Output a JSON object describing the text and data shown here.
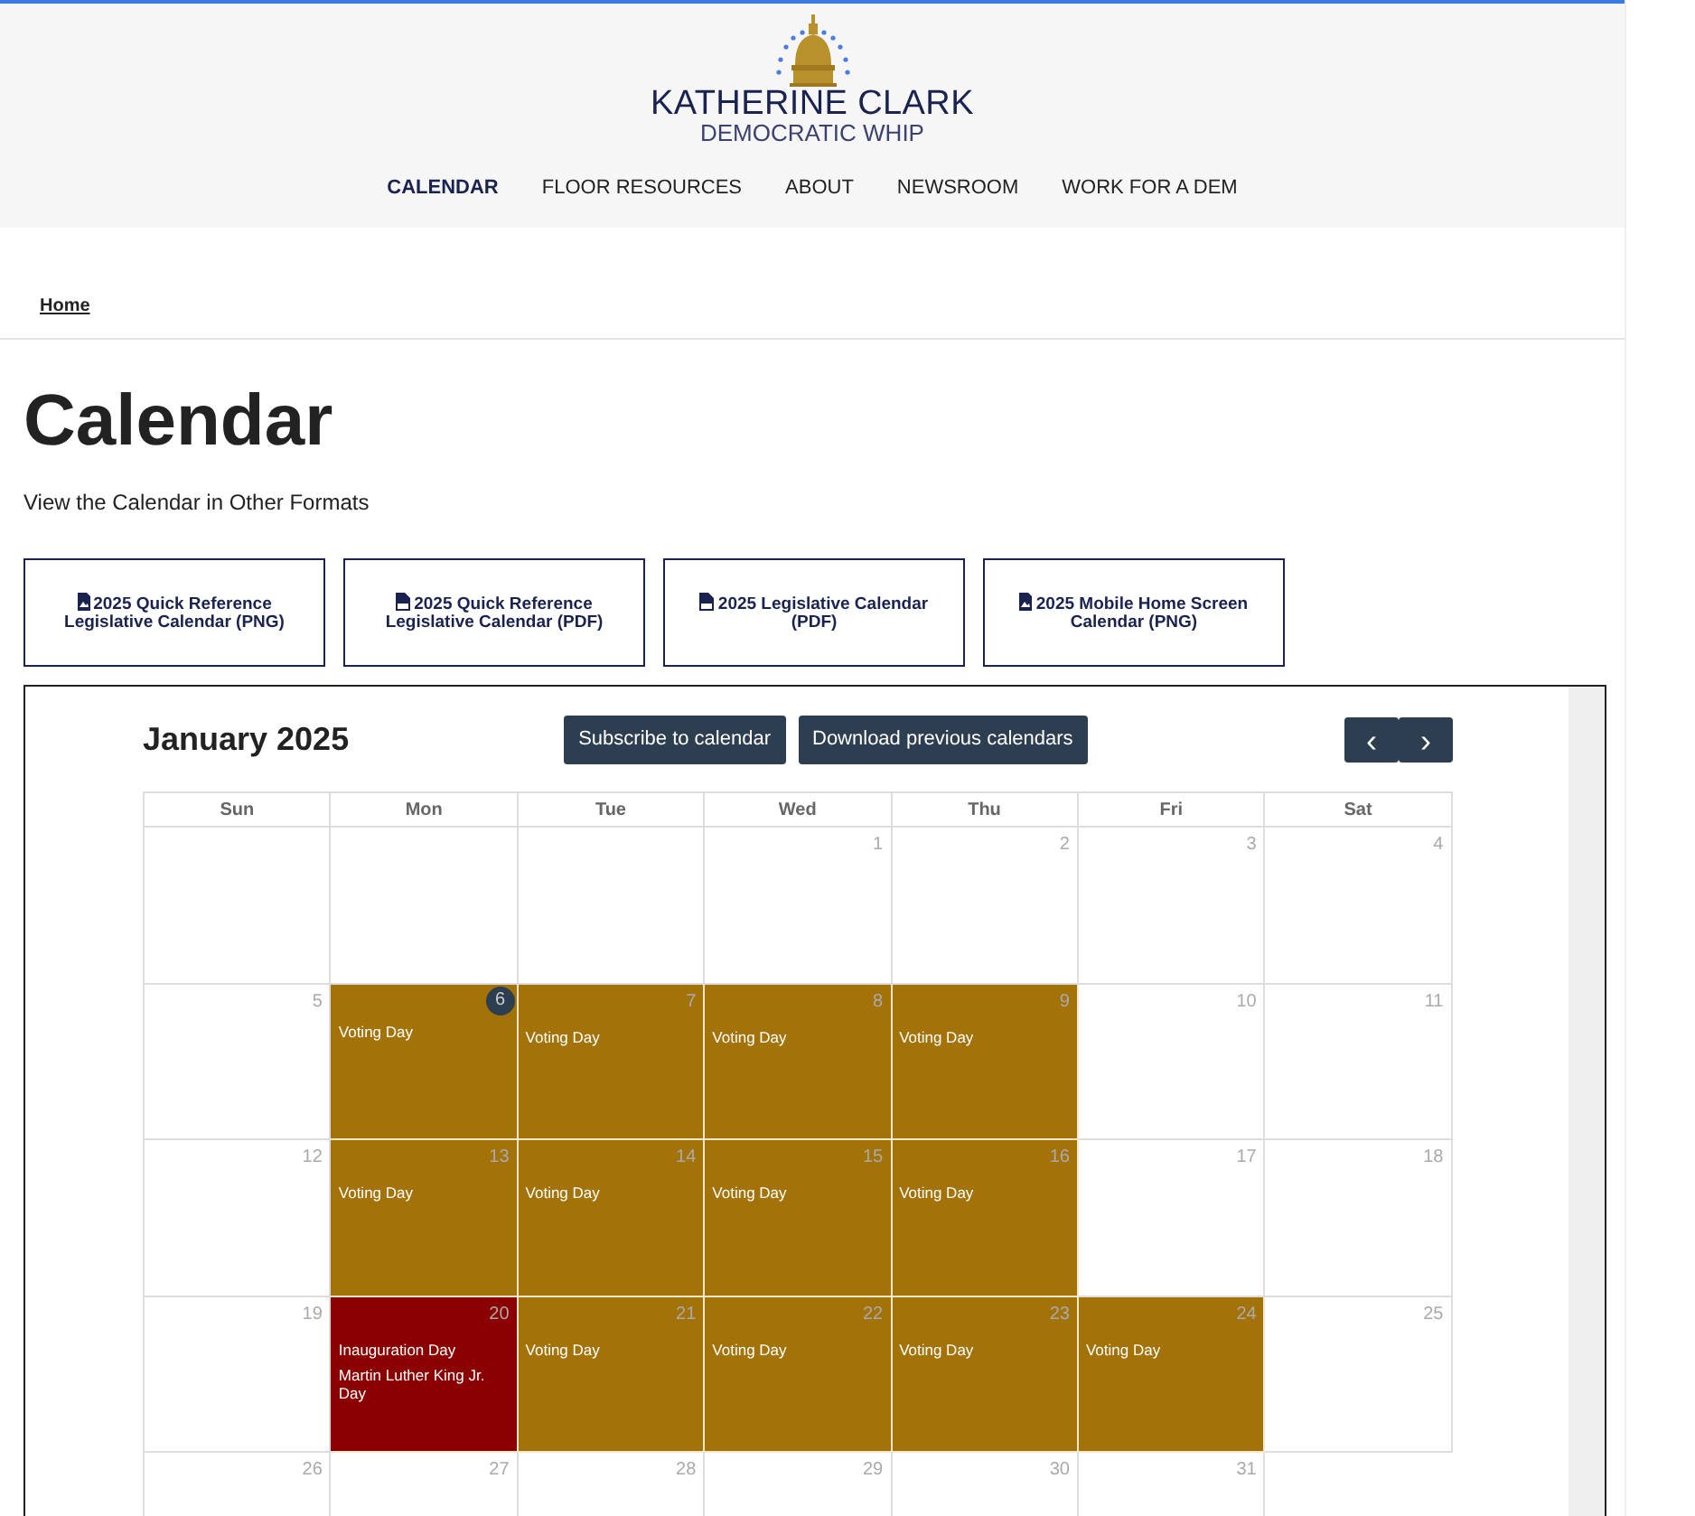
{
  "header": {
    "logo": {
      "name": "KATHERINE CLARK",
      "subtitle": "DEMOCRATIC WHIP"
    },
    "nav": [
      {
        "label": "CALENDAR",
        "selected": true
      },
      {
        "label": "FLOOR RESOURCES",
        "selected": false
      },
      {
        "label": "ABOUT",
        "selected": false
      },
      {
        "label": "NEWSROOM",
        "selected": false
      },
      {
        "label": "WORK FOR A DEM",
        "selected": false
      }
    ]
  },
  "breadcrumb": [
    "Home"
  ],
  "page": {
    "title": "Calendar",
    "subtitle": "View the Calendar in Other Formats"
  },
  "downloads": [
    {
      "label": "2025 Quick Reference Legislative Calendar (PNG)",
      "kind": "png"
    },
    {
      "label": "2025 Quick Reference Legislative Calendar (PDF)",
      "kind": "pdf"
    },
    {
      "label": "2025 Legislative Calendar (PDF)",
      "kind": "pdf"
    },
    {
      "label": "2025 Mobile Home Screen Calendar (PNG)",
      "kind": "png"
    }
  ],
  "calendar": {
    "month": "January 2025",
    "buttons": [
      "Subscribe to calendar",
      "Download previous calendars"
    ],
    "prev": "‹",
    "next": "›",
    "weekdays": [
      "Sun",
      "Mon",
      "Tue",
      "Wed",
      "Thu",
      "Fri",
      "Sat"
    ],
    "weeks": [
      [
        {
          "kind": "blank"
        },
        {
          "kind": "blank"
        },
        {
          "kind": "blank"
        },
        {
          "kind": "day",
          "number": "1",
          "today": false
        },
        {
          "kind": "day",
          "number": "2",
          "today": false
        },
        {
          "kind": "day",
          "number": "3",
          "today": false
        },
        {
          "kind": "day",
          "number": "4",
          "today": false
        }
      ],
      [
        {
          "kind": "day",
          "number": "5",
          "today": false
        },
        {
          "kind": "day",
          "number": "6",
          "today": true,
          "color": "#a37309",
          "events": [
            "Voting Day"
          ]
        },
        {
          "kind": "day",
          "number": "7",
          "today": false,
          "color": "#a37309",
          "events": [
            "Voting Day"
          ]
        },
        {
          "kind": "day",
          "number": "8",
          "today": false,
          "color": "#a37309",
          "events": [
            "Voting Day"
          ]
        },
        {
          "kind": "day",
          "number": "9",
          "today": false,
          "color": "#a37309",
          "events": [
            "Voting Day"
          ]
        },
        {
          "kind": "day",
          "number": "10",
          "today": false
        },
        {
          "kind": "day",
          "number": "11",
          "today": false
        }
      ],
      [
        {
          "kind": "day",
          "number": "12",
          "today": false
        },
        {
          "kind": "day",
          "number": "13",
          "today": false,
          "color": "#a37309",
          "events": [
            "Voting Day"
          ]
        },
        {
          "kind": "day",
          "number": "14",
          "today": false,
          "color": "#a37309",
          "events": [
            "Voting Day"
          ]
        },
        {
          "kind": "day",
          "number": "15",
          "today": false,
          "color": "#a37309",
          "events": [
            "Voting Day"
          ]
        },
        {
          "kind": "day",
          "number": "16",
          "today": false,
          "color": "#a37309",
          "events": [
            "Voting Day"
          ]
        },
        {
          "kind": "day",
          "number": "17",
          "today": false
        },
        {
          "kind": "day",
          "number": "18",
          "today": false
        }
      ],
      [
        {
          "kind": "day",
          "number": "19",
          "today": false
        },
        {
          "kind": "day",
          "number": "20",
          "today": false,
          "color": "#8b0000",
          "events": [
            "Inauguration Day",
            "Martin Luther King Jr. Day"
          ]
        },
        {
          "kind": "day",
          "number": "21",
          "today": false,
          "color": "#a37309",
          "events": [
            "Voting Day"
          ]
        },
        {
          "kind": "day",
          "number": "22",
          "today": false,
          "color": "#a37309",
          "events": [
            "Voting Day"
          ]
        },
        {
          "kind": "day",
          "number": "23",
          "today": false,
          "color": "#a37309",
          "events": [
            "Voting Day"
          ]
        },
        {
          "kind": "day",
          "number": "24",
          "today": false,
          "color": "#a37309",
          "events": [
            "Voting Day"
          ]
        },
        {
          "kind": "day",
          "number": "25",
          "today": false
        }
      ],
      [
        {
          "kind": "day",
          "number": "26",
          "today": false
        },
        {
          "kind": "day",
          "number": "27",
          "today": false
        },
        {
          "kind": "day",
          "number": "28",
          "today": false
        },
        {
          "kind": "day",
          "number": "29",
          "today": false
        },
        {
          "kind": "day",
          "number": "30",
          "today": false
        },
        {
          "kind": "day",
          "number": "31",
          "today": false
        }
      ]
    ]
  }
}
